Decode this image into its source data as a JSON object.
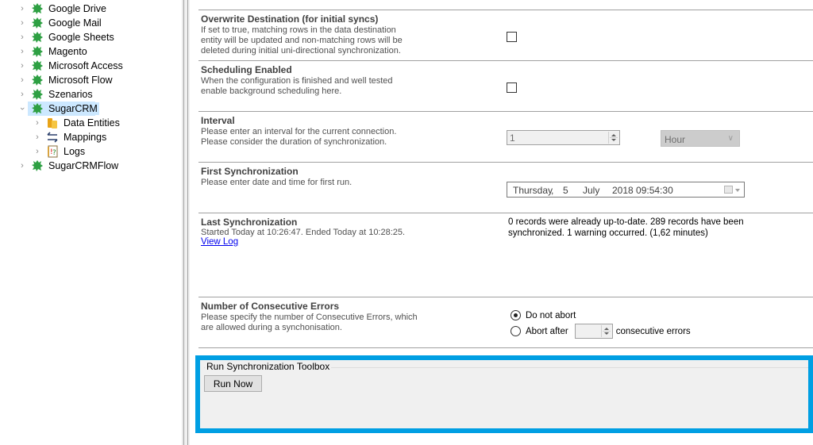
{
  "tree": {
    "items": [
      {
        "label": "Google Drive",
        "icon": "connection-puzzle-icon",
        "expanded": false
      },
      {
        "label": "Google Mail",
        "icon": "connection-puzzle-icon",
        "expanded": false
      },
      {
        "label": "Google Sheets",
        "icon": "connection-puzzle-icon",
        "expanded": false
      },
      {
        "label": "Magento",
        "icon": "connection-puzzle-icon",
        "expanded": false
      },
      {
        "label": "Microsoft Access",
        "icon": "connection-puzzle-icon",
        "expanded": false
      },
      {
        "label": "Microsoft Flow",
        "icon": "connection-puzzle-icon",
        "expanded": false
      },
      {
        "label": "Szenarios",
        "icon": "connection-puzzle-icon",
        "expanded": false
      },
      {
        "label": "SugarCRM",
        "icon": "connection-puzzle-icon",
        "expanded": true,
        "selected": true,
        "children": [
          {
            "label": "Data Entities",
            "icon": "data-entities-icon"
          },
          {
            "label": "Mappings",
            "icon": "mappings-icon"
          },
          {
            "label": "Logs",
            "icon": "logs-icon"
          }
        ]
      },
      {
        "label": "SugarCRMFlow",
        "icon": "connection-puzzle-icon",
        "expanded": false
      }
    ]
  },
  "settings": {
    "overwrite": {
      "title": "Overwrite Destination (for initial syncs)",
      "description": "If set to true, matching rows in the data destination entity will be updated and non-matching rows will be deleted during initial uni-directional synchronization.",
      "checked": false
    },
    "scheduling": {
      "title": "Scheduling Enabled",
      "description": "When the configuration is finished and well tested enable background scheduling here.",
      "checked": false
    },
    "interval": {
      "title": "Interval",
      "description": "Please enter an interval for the current connection. Please consider the duration of synchronization.",
      "value": "1",
      "unit": "Hour"
    },
    "first_sync": {
      "title": "First Synchronization",
      "description": "Please enter date and time for first run.",
      "weekday": "Thursday",
      "sep": ",",
      "day": "5",
      "month": "July",
      "year_time": "2018 09:54:30"
    },
    "last_sync": {
      "title": "Last Synchronization",
      "description": "Started  Today at 10:26:47. Ended Today at 10:28:25.",
      "link": "View Log",
      "result": "0 records were already up-to-date. 289 records have been synchronized. 1 warning occurred. (1,62 minutes)"
    },
    "errors": {
      "title": "Number of Consecutive Errors",
      "description": "Please specify the number of Consecutive Errors, which are allowed during a synchonisation.",
      "option_no_abort": "Do not abort",
      "option_abort_after": "Abort after",
      "abort_suffix": "consecutive errors",
      "selected": "Do not abort",
      "abort_value": ""
    }
  },
  "toolbox": {
    "title": "Run Synchronization Toolbox",
    "run_now": "Run Now",
    "highlight_color": "#009fe3"
  }
}
